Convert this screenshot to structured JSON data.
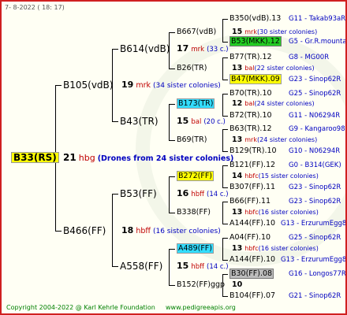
{
  "header": {
    "date": "7-   8-2022 (  18:  17)"
  },
  "footer": {
    "copyright": "Copyright 2004-2022 @ Karl Kehrle Foundation",
    "site": "www.pedigreeapis.org"
  },
  "root": {
    "name": "B33(RS)",
    "num": "21",
    "sym": "hbg",
    "note": "(Drones from 24 sister colonies)"
  },
  "gen1": [
    {
      "name": "B105(vdB)",
      "num": "19",
      "sym": "mrk",
      "note": "(34 sister colonies)"
    },
    {
      "name": "B466(FF)",
      "num": "18",
      "sym": "hbff",
      "note": "(16 sister colonies)"
    }
  ],
  "gen2": [
    {
      "name": "B614(vdB)",
      "num": "17",
      "sym": "mrk",
      "note": "(33 c.)"
    },
    {
      "name": "B43(TR)",
      "num": "15",
      "sym": "bal",
      "note": "(20 c.)"
    },
    {
      "name": "B53(FF)",
      "num": "16",
      "sym": "hbff",
      "note": "(14 c.)"
    },
    {
      "name": "A558(FF)",
      "num": "15",
      "sym": "hbff",
      "note": "(14 c.)"
    }
  ],
  "gen3": [
    {
      "name": "B667(vdB)",
      "num": "15",
      "sym": "mrk",
      "note": "(30 sister colonies)"
    },
    {
      "name": "B26(TR)",
      "num": "13",
      "sym": "bal",
      "note": "(22 sister colonies)"
    },
    {
      "name": "B173(TR)",
      "num": "12",
      "sym": "bal",
      "note": "(24 sister colonies)"
    },
    {
      "name": "B69(TR)",
      "num": "13",
      "sym": "mrk",
      "note": "(24 sister colonies)"
    },
    {
      "name": "B272(FF)",
      "num": "14",
      "sym": "hbfc",
      "note": "(15 sister colonies)"
    },
    {
      "name": "B338(FF)",
      "num": "13",
      "sym": "hbfc",
      "note": "(16 sister colonies)"
    },
    {
      "name": "A489(FF)",
      "num": "13",
      "sym": "hbfc",
      "note": "(16 sister colonies)"
    },
    {
      "name": "B152(FF)ggp",
      "num": "10",
      "sym": "",
      "note": ""
    }
  ],
  "gen4": [
    {
      "name": "B350(vdB).13",
      "code": "G11 - Takab93aR"
    },
    {
      "name": "B53(MKK).12",
      "code": "G5 - Gr.R.mounta"
    },
    {
      "name": "B77(TR).12",
      "code": "G8 - MG00R"
    },
    {
      "name": "B47(MKK).09",
      "code": "G23 - Sinop62R"
    },
    {
      "name": "B70(TR).10",
      "code": "G25 - Sinop62R"
    },
    {
      "name": "B72(TR).10",
      "code": "G11 - N06294R"
    },
    {
      "name": "B63(TR).12",
      "code": "G9 - Kangaroo98R"
    },
    {
      "name": "B129(TR).10",
      "code": "G10 - N06294R"
    },
    {
      "name": "B121(FF).12",
      "code": "G0 - B314(GEK)"
    },
    {
      "name": "B307(FF).11",
      "code": "G23 - Sinop62R"
    },
    {
      "name": "B66(FF).11",
      "code": "G23 - Sinop62R"
    },
    {
      "name": "A144(FF).10",
      "code": "G13 - ErzurumEgg8"
    },
    {
      "name": "A04(FF).10",
      "code": "G25 - Sinop62R"
    },
    {
      "name": "A144(FF).10",
      "code": "G13 - ErzurumEgg8"
    },
    {
      "name": "B30(FF).08",
      "code": "G16 - Longos77R"
    },
    {
      "name": "B104(FF).07",
      "code": "G21 - Sinop62R"
    }
  ]
}
